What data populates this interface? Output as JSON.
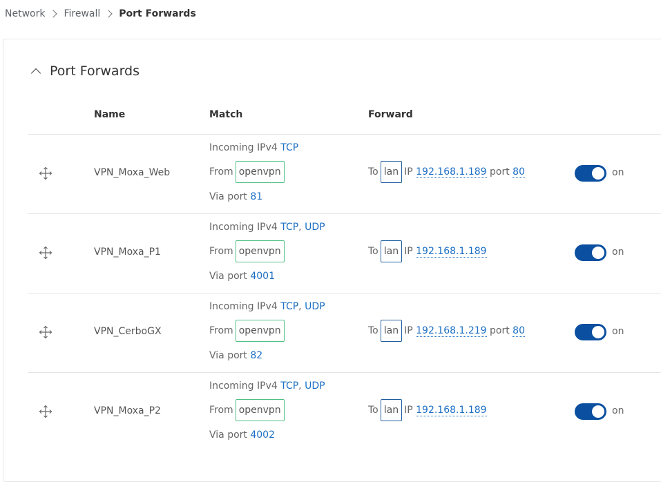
{
  "breadcrumb": {
    "items": [
      "Network",
      "Firewall"
    ],
    "current": "Port Forwards"
  },
  "section": {
    "title": "Port Forwards"
  },
  "columns": {
    "name": "Name",
    "match": "Match",
    "forward": "Forward"
  },
  "labels": {
    "incoming": "Incoming IPv4",
    "from": "From",
    "via_port": "Via port",
    "to": "To",
    "ip": "IP",
    "port": "port",
    "comma": ","
  },
  "rules": [
    {
      "name": "VPN_Moxa_Web",
      "protocols": [
        "TCP"
      ],
      "from_zone": "openvpn",
      "via_port": "81",
      "to_zone": "lan",
      "ip": "192.168.1.189",
      "dest_port": "80",
      "enabled": true,
      "state": "on"
    },
    {
      "name": "VPN_Moxa_P1",
      "protocols": [
        "TCP",
        "UDP"
      ],
      "from_zone": "openvpn",
      "via_port": "4001",
      "to_zone": "lan",
      "ip": "192.168.1.189",
      "dest_port": "",
      "enabled": true,
      "state": "on"
    },
    {
      "name": "VPN_CerboGX",
      "protocols": [
        "TCP",
        "UDP"
      ],
      "from_zone": "openvpn",
      "via_port": "82",
      "to_zone": "lan",
      "ip": "192.168.1.219",
      "dest_port": "80",
      "enabled": true,
      "state": "on"
    },
    {
      "name": "VPN_Moxa_P2",
      "protocols": [
        "TCP",
        "UDP"
      ],
      "from_zone": "openvpn",
      "via_port": "4002",
      "to_zone": "lan",
      "ip": "192.168.1.189",
      "dest_port": "",
      "enabled": true,
      "state": "on"
    }
  ]
}
